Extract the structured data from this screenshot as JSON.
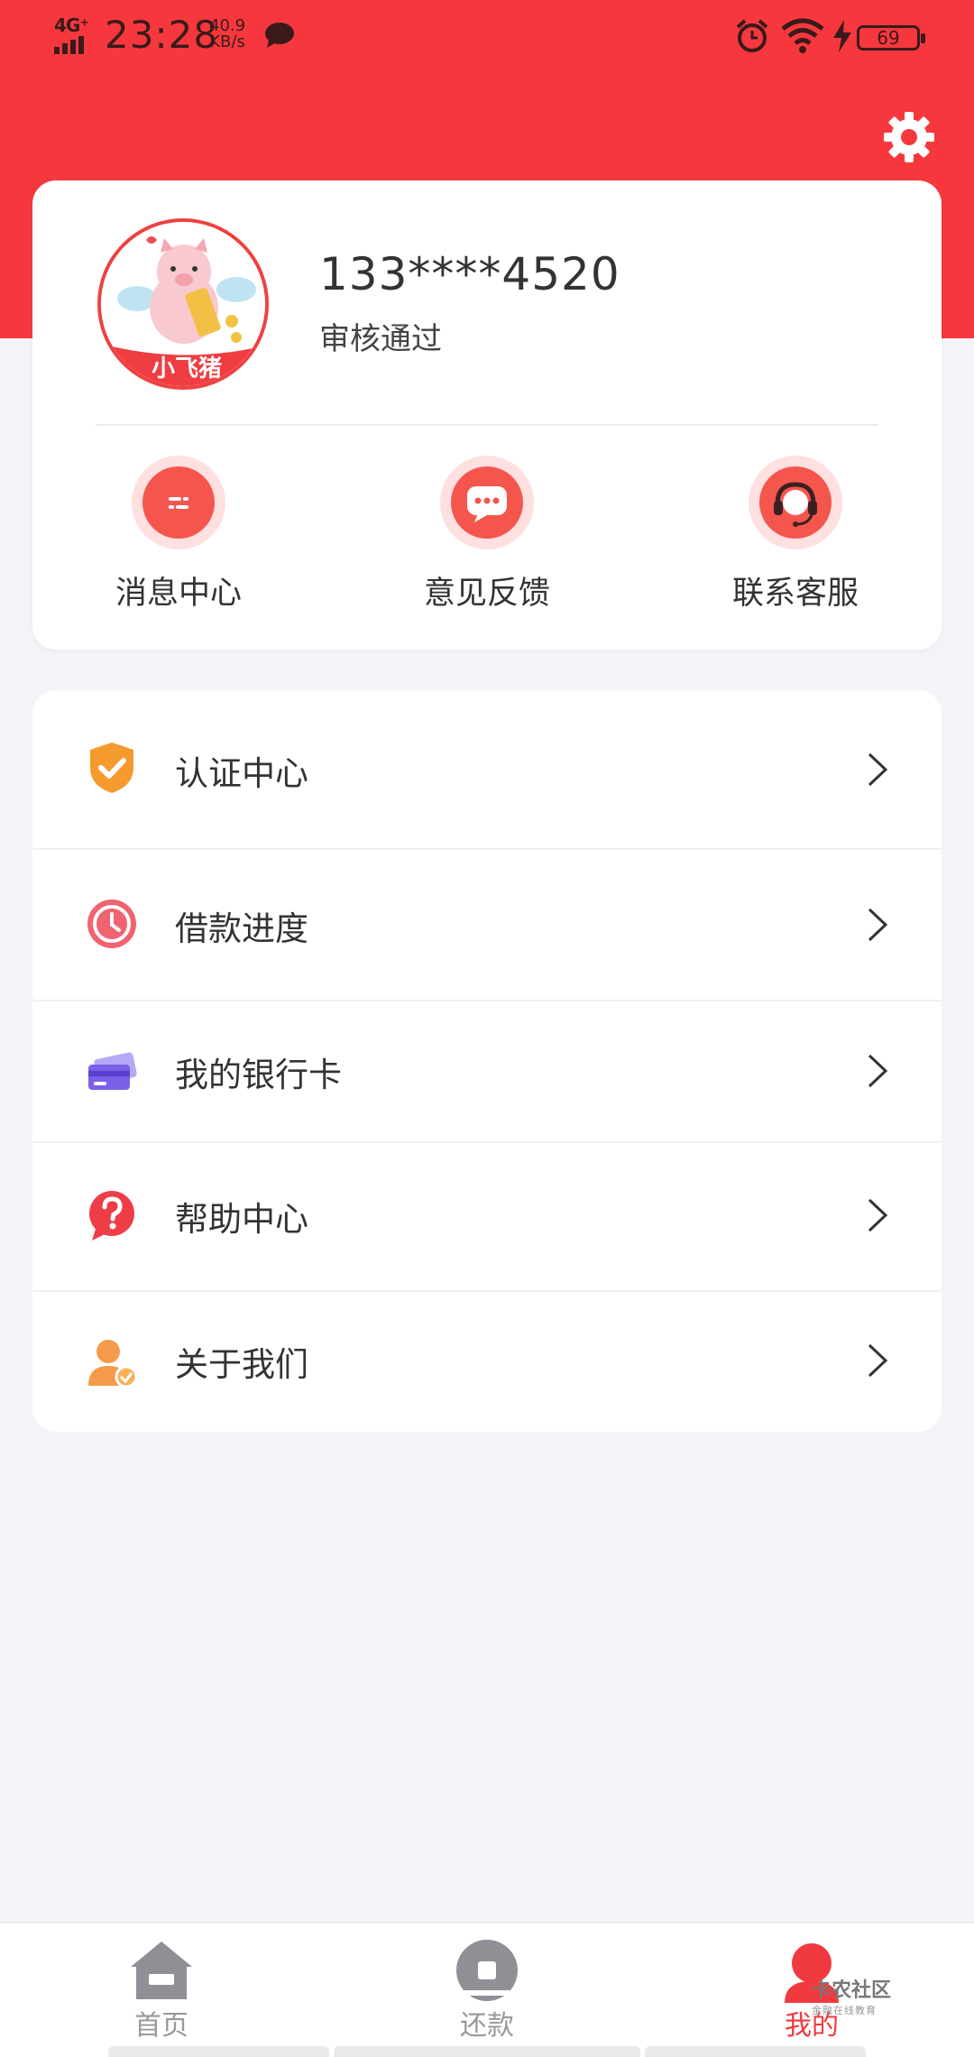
{
  "status_bar": {
    "network": "4G⁺",
    "time": "23:28",
    "speed_value": "40.9",
    "speed_unit": "KB/s",
    "battery": "69",
    "icons": [
      "wechat-icon",
      "alarm-icon",
      "wifi-icon",
      "charging-icon",
      "battery-icon"
    ]
  },
  "header": {
    "settings_icon": "gear-icon",
    "accent_color": "#f6383e"
  },
  "profile": {
    "phone": "133****4520",
    "status": "审核通过",
    "avatar_text": "小飞猪"
  },
  "quick_actions": [
    {
      "label": "消息中心",
      "icon": "message-icon"
    },
    {
      "label": "意见反馈",
      "icon": "feedback-chat-icon"
    },
    {
      "label": "联系客服",
      "icon": "customer-service-icon"
    }
  ],
  "menu": [
    {
      "label": "认证中心",
      "icon": "shield-check-icon"
    },
    {
      "label": "借款进度",
      "icon": "clock-icon"
    },
    {
      "label": "我的银行卡",
      "icon": "bank-card-icon"
    },
    {
      "label": "帮助中心",
      "icon": "help-question-icon"
    },
    {
      "label": "关于我们",
      "icon": "about-user-icon"
    }
  ],
  "tabs": [
    {
      "label": "首页",
      "icon": "home-icon",
      "active": false
    },
    {
      "label": "还款",
      "icon": "repay-icon",
      "active": false
    },
    {
      "label": "我的",
      "icon": "profile-icon",
      "active": true
    }
  ],
  "watermark": {
    "title": "卡农社区",
    "subtitle": "金融在线教育"
  }
}
